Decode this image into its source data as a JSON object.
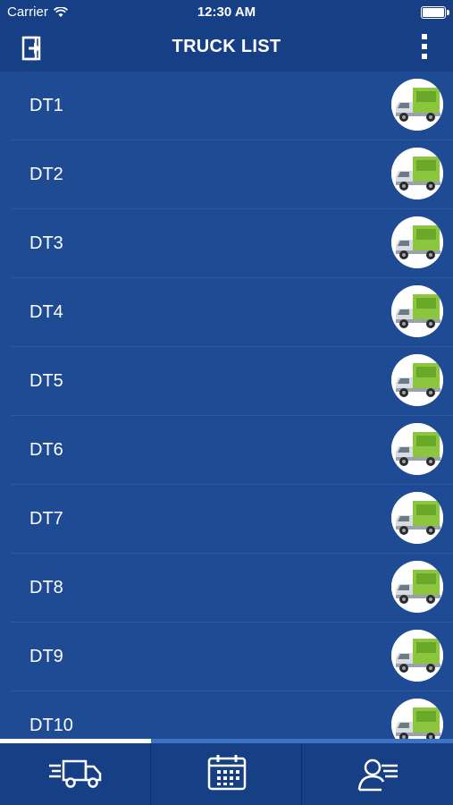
{
  "status_bar": {
    "carrier": "Carrier",
    "time": "12:30 AM"
  },
  "nav": {
    "title": "TRUCK LIST",
    "left_icon": "logout-icon",
    "right_icon": "more-vertical-icon"
  },
  "trucks": [
    {
      "label": "DT1"
    },
    {
      "label": "DT2"
    },
    {
      "label": "DT3"
    },
    {
      "label": "DT4"
    },
    {
      "label": "DT5"
    },
    {
      "label": "DT6"
    },
    {
      "label": "DT7"
    },
    {
      "label": "DT8"
    },
    {
      "label": "DT9"
    },
    {
      "label": "DT10"
    }
  ],
  "tabs": [
    {
      "icon": "truck-icon",
      "active": true
    },
    {
      "icon": "calendar-icon",
      "active": false
    },
    {
      "icon": "user-profile-icon",
      "active": false
    }
  ],
  "colors": {
    "background": "#1e4b94",
    "bar": "#163f86",
    "active_tab_indicator": "#ffffff",
    "inactive_tab_indicator": "#3c73c4"
  }
}
